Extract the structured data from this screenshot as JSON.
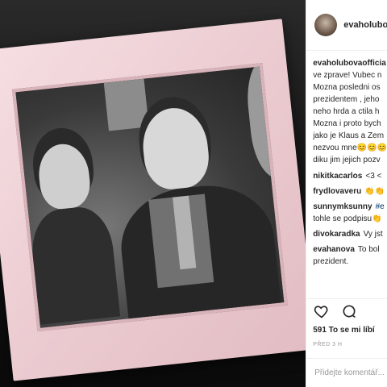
{
  "post": {
    "photo_alt": "Framed black and white photo",
    "author": "evaholubovaofficial",
    "header_username": "evaholubo",
    "caption_lines": [
      "ve zprave! Vubec n",
      "Mozna posledni os",
      "prezidentem , jeho",
      "neho hrda a ctila h",
      "Mozna i proto bych",
      "jako je Klaus a Zem",
      "nezvou mne😊😊😊",
      "diku jim jejich pozv"
    ],
    "caption_first_user": "evaholubovaofficia"
  },
  "comments": [
    {
      "user": "nikitkacarlos",
      "text": "<3 <"
    },
    {
      "user": "frydlovaveru",
      "text": "👏👏 "
    },
    {
      "user": "sunnymksunny",
      "text": "#e",
      "extra": "tohle se podpisu👏"
    },
    {
      "user": "divokaradka",
      "text": "Vy jst"
    },
    {
      "user": "evahanova",
      "text": "To bol",
      "extra": "prezident."
    }
  ],
  "actions": {
    "like_icon": "heart-icon",
    "comment_icon": "comment-icon",
    "likes_text": "591 To se mi líbí",
    "time_text": "PŘED 3 H",
    "add_comment_placeholder": "Přidejte komentář..."
  }
}
